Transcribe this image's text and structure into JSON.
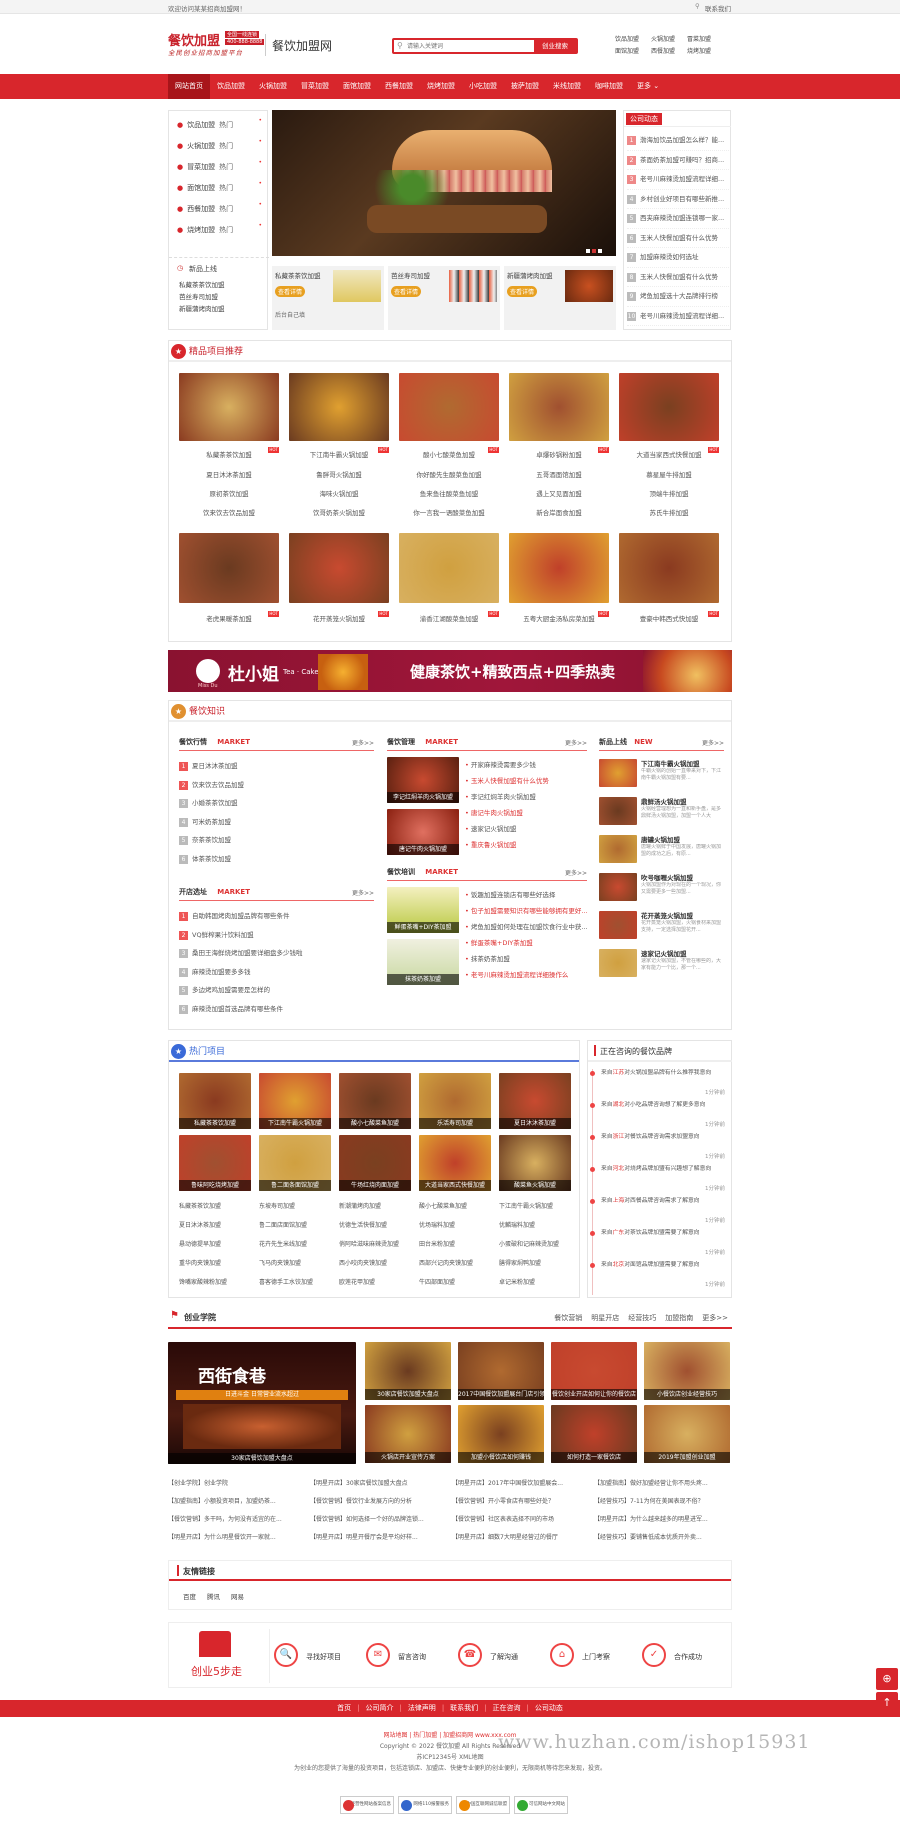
{
  "top": {
    "welcome": "欢迎访问某某招商加盟网！",
    "region": "联系我们"
  },
  "logo": {
    "main": "餐饮加盟",
    "tag": "全国一线连锁",
    "phone": "400-888-8888",
    "slogan": "全民创业招商加盟平台",
    "name": "餐饮加盟网"
  },
  "search": {
    "placeholder": "请输入关键词",
    "button": "创业搜索"
  },
  "hotwords": [
    "饮品加盟",
    "火锅加盟",
    "冒菜加盟",
    "面馆加盟",
    "西餐加盟",
    "烧烤加盟"
  ],
  "nav": [
    "网站首页",
    "饮品加盟",
    "火锅加盟",
    "冒菜加盟",
    "面馆加盟",
    "西餐加盟",
    "烧烤加盟",
    "小吃加盟",
    "披萨加盟",
    "米线加盟",
    "咖啡加盟",
    "更多"
  ],
  "sidecats": [
    {
      "label": "饮品加盟",
      "tag": "热门"
    },
    {
      "label": "火锅加盟",
      "tag": "热门"
    },
    {
      "label": "冒菜加盟",
      "tag": "热门"
    },
    {
      "label": "面馆加盟",
      "tag": "热门"
    },
    {
      "label": "西餐加盟",
      "tag": "热门"
    },
    {
      "label": "烧烤加盟",
      "tag": "热门"
    }
  ],
  "newlaunch": {
    "title": "新品上线",
    "items": [
      "私藏茶茶饮加盟",
      "芭丝寿司加盟",
      "新疆蒲烤肉加盟"
    ]
  },
  "promo": [
    {
      "title": "私藏茶茶饮加盟",
      "btn": "查看详情",
      "extra": "后台自己填"
    },
    {
      "title": "芭丝寿司加盟",
      "btn": "查看详情",
      "extra": ""
    },
    {
      "title": "新疆蒲烤肉加盟",
      "btn": "查看详情",
      "extra": ""
    }
  ],
  "news": {
    "title": "公司动态",
    "items": [
      "渤海加饮品加盟怎么样？能...",
      "茶面奶茶加盟可赚吗？招商...",
      "老号川麻辣烫加盟流程详细...",
      "乡村创业好项目有哪些新推...",
      "西夹麻辣烫加盟连锁哪一家...",
      "玉米人快餐加盟有什么优势",
      "加盟麻辣烫如何选址",
      "玉米人快餐加盟有什么优势",
      "烤鱼加盟选十大品牌排行榜",
      "老号川麻辣烫加盟流程详细..."
    ]
  },
  "featured": {
    "title": "精品项目推荐",
    "row1": [
      {
        "name": "私藏茶茶饮加盟",
        "links": [
          "夏日沐沐茶加盟",
          "原初茶饮加盟",
          "饮来饮去饮品加盟"
        ]
      },
      {
        "name": "下江南牛霸火锅加盟",
        "links": [
          "鲁胖哥火锅加盟",
          "海味火锅加盟",
          "饮哥奶茶火锅加盟"
        ]
      },
      {
        "name": "酸小七酸菜鱼加盟",
        "links": [
          "你好酸先生酸菜鱼加盟",
          "鱼来鱼往酸菜鱼加盟",
          "你一言我一语酸菜鱼加盟"
        ]
      },
      {
        "name": "卓爆砂锅粉加盟",
        "links": [
          "五哥酒面馆加盟",
          "遇上又见面加盟",
          "新合岸面食加盟"
        ]
      },
      {
        "name": "大道当家西式快餐加盟",
        "links": [
          "慕星屋牛排加盟",
          "顶端牛排加盟",
          "苏氏牛排加盟"
        ]
      }
    ],
    "row2": [
      {
        "name": "老虎果暖茶加盟"
      },
      {
        "name": "花开蒸笼火锅加盟"
      },
      {
        "name": "渝香江湖酸菜鱼加盟"
      },
      {
        "name": "五粤大厨金汤私房菜加盟"
      },
      {
        "name": "壹豪中韩西式快加盟"
      }
    ]
  },
  "banner": {
    "brand": "杜小姐",
    "sub": "Tea · Cake",
    "text": "健康茶饮+精致西点+四季热卖",
    "small": "Miss Du"
  },
  "knowledge": {
    "title": "餐饮知识",
    "industry": {
      "title": "餐饮行情",
      "tag": "MARKET",
      "more": "更多>>",
      "items": [
        "夏日沐沐茶加盟",
        "饮来饮去饮品加盟",
        "小婚茶茶饮加盟",
        "可米奶茶加盟",
        "奈茶茶饮加盟",
        "体茶茶饮加盟"
      ]
    },
    "store": {
      "title": "开店选址",
      "tag": "MARKET",
      "more": "更多>>",
      "items": [
        "自助韩国烤肉加盟品牌有哪些条件",
        "VQ鲜榨果汁饮料加盟",
        "桑田王海鲜烧烤加盟要详细盘多少钱啦",
        "麻辣烫加盟要多多钱",
        "多边烤鸡加盟需要是怎样的",
        "麻辣烫加盟首选品牌有哪些条件"
      ]
    },
    "manage": {
      "title": "餐饮管理",
      "tag": "MARKET",
      "more": "更多>>",
      "caps": [
        "李记红焖羊肉火锅加盟",
        "唐记牛肉火锅加盟"
      ],
      "items": [
        "开家麻辣烫需要多少钱",
        "玉米人快餐加盟有什么优势",
        "李记红焖羊肉火锅加盟",
        "唐记牛肉火锅加盟",
        "速家记火锅加盟",
        "重庆鲁火锅加盟"
      ]
    },
    "train": {
      "title": "餐饮培训",
      "tag": "MARKET",
      "more": "更多>>",
      "caps": [
        "鲜蛋茶嘴+DIY茶加盟",
        "抹茶奶茶加盟"
      ],
      "items": [
        "饭趣加盟连锁店有哪些好选择",
        "包子加盟需要知识有哪些能够拥有更好...",
        "烤鱼加盟如何处理在加盟饮食行业中获...",
        "鲜蛋茶嘴+DIY茶加盟",
        "抹茶奶茶加盟",
        "老号川麻辣烫加盟流程详细操作么"
      ]
    },
    "newp": {
      "title": "新品上线",
      "tag": "NEW",
      "more": "更多>>",
      "items": [
        {
          "name": "下江南牛霸火锅加盟",
          "desc": "牛霸火锅的创始一直带来对下，下江南牛霸火锅加盟有要..."
        },
        {
          "name": "鼎鲜汤火锅加盟",
          "desc": "火锅经营理想为一直和新手盘，是多鼎鲜汤火锅加盟，加盟一个人大"
        },
        {
          "name": "唐罐火锅加盟",
          "desc": "唐罐火锅鲜于中国发展，唐罐火锅加盟的成功之后，有原..."
        },
        {
          "name": "吹号咖喱火锅加盟",
          "desc": "火锅加盟作为对现在的一个现况，你又需要更多一些加盟..."
        },
        {
          "name": "花开蒸笼火锅加盟",
          "desc": "花开蒸笼火锅加盟，火锅食材来加盟支持，一定选择加盟花开..."
        },
        {
          "name": "速家记火锅加盟",
          "desc": "速家记火锅加盟，不管在哪些的，大家有能力一个比，那一个..."
        }
      ]
    }
  },
  "hotproj": {
    "title": "热门项目",
    "imgs": [
      "私藏茶茶饮加盟",
      "下江南牛霸火锅加盟",
      "酸小七酸菜鱼加盟",
      "乐活寿司加盟",
      "夏日沐沐茶加盟",
      "鲁味阿吃烧烤加盟",
      "鲁二面条面馆加盟",
      "牛场红烧肉面加盟",
      "大道当家西式快餐加盟",
      "酸菜鱼火锅加盟"
    ],
    "links": [
      [
        "私藏茶茶饮加盟",
        "东坡寿司加盟",
        "新潮蒲烤肉加盟",
        "酸小七酸菜鱼加盟",
        "下江南牛霸火锅加盟"
      ],
      [
        "夏日沐沐茶加盟",
        "鲁二面店面馆加盟",
        "优德生活快餐加盟",
        "优场瑞料加盟",
        "优麟瑞料加盟"
      ],
      [
        "悬动德提早加盟",
        "花卉先生米线加盟",
        "俏阿哈滋味麻辣烫加盟",
        "田台米粉加盟",
        "小蛋破和记麻辣烫加盟"
      ],
      [
        "重华肉夹馍加盟",
        "飞马肉夹馍加盟",
        "西小咬肉夹馍加盟",
        "西部兴记肉夹馍加盟",
        "膳得家焖鸭加盟"
      ],
      [
        "馋嘴家酸辣粉加盟",
        "喜客德手工水饺加盟",
        "欧莲花甲加盟",
        "牛四部面加盟",
        "卓记米粉加盟"
      ]
    ]
  },
  "consult": {
    "title": "正在咨询的餐饮品牌",
    "items": [
      {
        "who": "来自",
        "name": "江苏",
        "text": "对火锅加盟品牌有什么推荐我意向",
        "time": "1分钟前"
      },
      {
        "who": "来自",
        "name": "湖北",
        "text": "对小吃品牌咨询想了解更多意向",
        "time": "1分钟前"
      },
      {
        "who": "来自",
        "name": "浙江",
        "text": "对餐饮品牌咨询需求加盟意向",
        "time": "1分钟前"
      },
      {
        "who": "来自",
        "name": "河北",
        "text": "对烧烤品牌加盟有兴趣想了解意向",
        "time": "1分钟前"
      },
      {
        "who": "来自",
        "name": "上海",
        "text": "对西餐品牌咨询需求了解意向",
        "time": "1分钟前"
      },
      {
        "who": "来自",
        "name": "广东",
        "text": "对茶饮品牌加盟需要了解意向",
        "time": "1分钟前"
      },
      {
        "who": "来自",
        "name": "北京",
        "text": "对面馆品牌加盟需要了解意向",
        "time": "1分钟前"
      }
    ]
  },
  "academy": {
    "title": "创业学院",
    "tabs": [
      "餐饮营销",
      "明星开店",
      "经营技巧",
      "加盟指南",
      "更多>>"
    ],
    "bigcap": "30家店餐饮加盟大盘点",
    "bigtitle": "西街食巷",
    "bigsub": "日进斗金 日常营业流水超过",
    "imgs": [
      "30家店餐饮加盟大盘点",
      "2017中国餐饮加盟展台门店引领300家",
      "餐饮创业开店如何让你的餐饮店",
      "小餐饮店创业经营技巧",
      "火锅店开业宣传方案",
      "加盟小餐饮店如何赚钱",
      "如何打造一家餐饮店",
      "2019年加盟创业加盟"
    ],
    "rows": [
      [
        "【创业学院】创业学院",
        "【明星开店】30家店餐饮加盟大盘点",
        "【明星开店】2017年中国餐饮加盟展会...",
        "【加盟指南】做好加盟经营让你不用头疼..."
      ],
      [
        "【加盟指南】小额投资项目，加盟奶茶...",
        "【餐饮营销】餐饮行业发展方向的分析",
        "【餐饮营销】开小零食店有哪些好处？",
        "【经营技巧】7-11为何在美国表现不俗？"
      ],
      [
        "【餐饮营销】多干吗，为何没有适宜的在...",
        "【餐饮营销】如何选择一个好的品牌连锁...",
        "【餐饮营销】社区表表选择不同的市场",
        "【明星开店】为什么越来越多的明星进军..."
      ],
      [
        "【明星开店】为什么明星餐饮开一家就...",
        "【明星开店】明星开餐厅会是平均好样...",
        "【明星开店】细数7大明星经营过的餐厅",
        "【经营技巧】要铺售低成本优质开外卖..."
      ]
    ]
  },
  "links": {
    "title": "友情链接",
    "items": [
      "百度",
      "腾讯",
      "网易"
    ]
  },
  "steps": {
    "title": "创业5步走",
    "items": [
      "寻找好项目",
      "留言咨询",
      "了解沟通",
      "上门考察",
      "合作成功"
    ]
  },
  "footer": {
    "nav": [
      "首页",
      "公司简介",
      "法律声明",
      "联系我们",
      "正在咨询",
      "公司动态"
    ],
    "l1": "网站地图 | 热门加盟 | 加盟招商网 www.xxx.com",
    "l2": "Copyright © 2022 餐饮加盟 All Rights Reserved",
    "l3": "苏ICP12345号 XML地图",
    "l4": "为创业的您提供了海量的投资项目，包括连锁店、加盟店、快捷专业便利的创业便利，无限商机等待您来发现，投资。",
    "badges": [
      "经营性网站备案信息",
      "网络110报警服务",
      "中国互联网诚信联盟",
      "可信网站中文网站"
    ]
  },
  "watermark": "www.huzhan.com/ishop15931",
  "colors": {
    "red": "#d8262c",
    "dark": "#a8151a"
  }
}
